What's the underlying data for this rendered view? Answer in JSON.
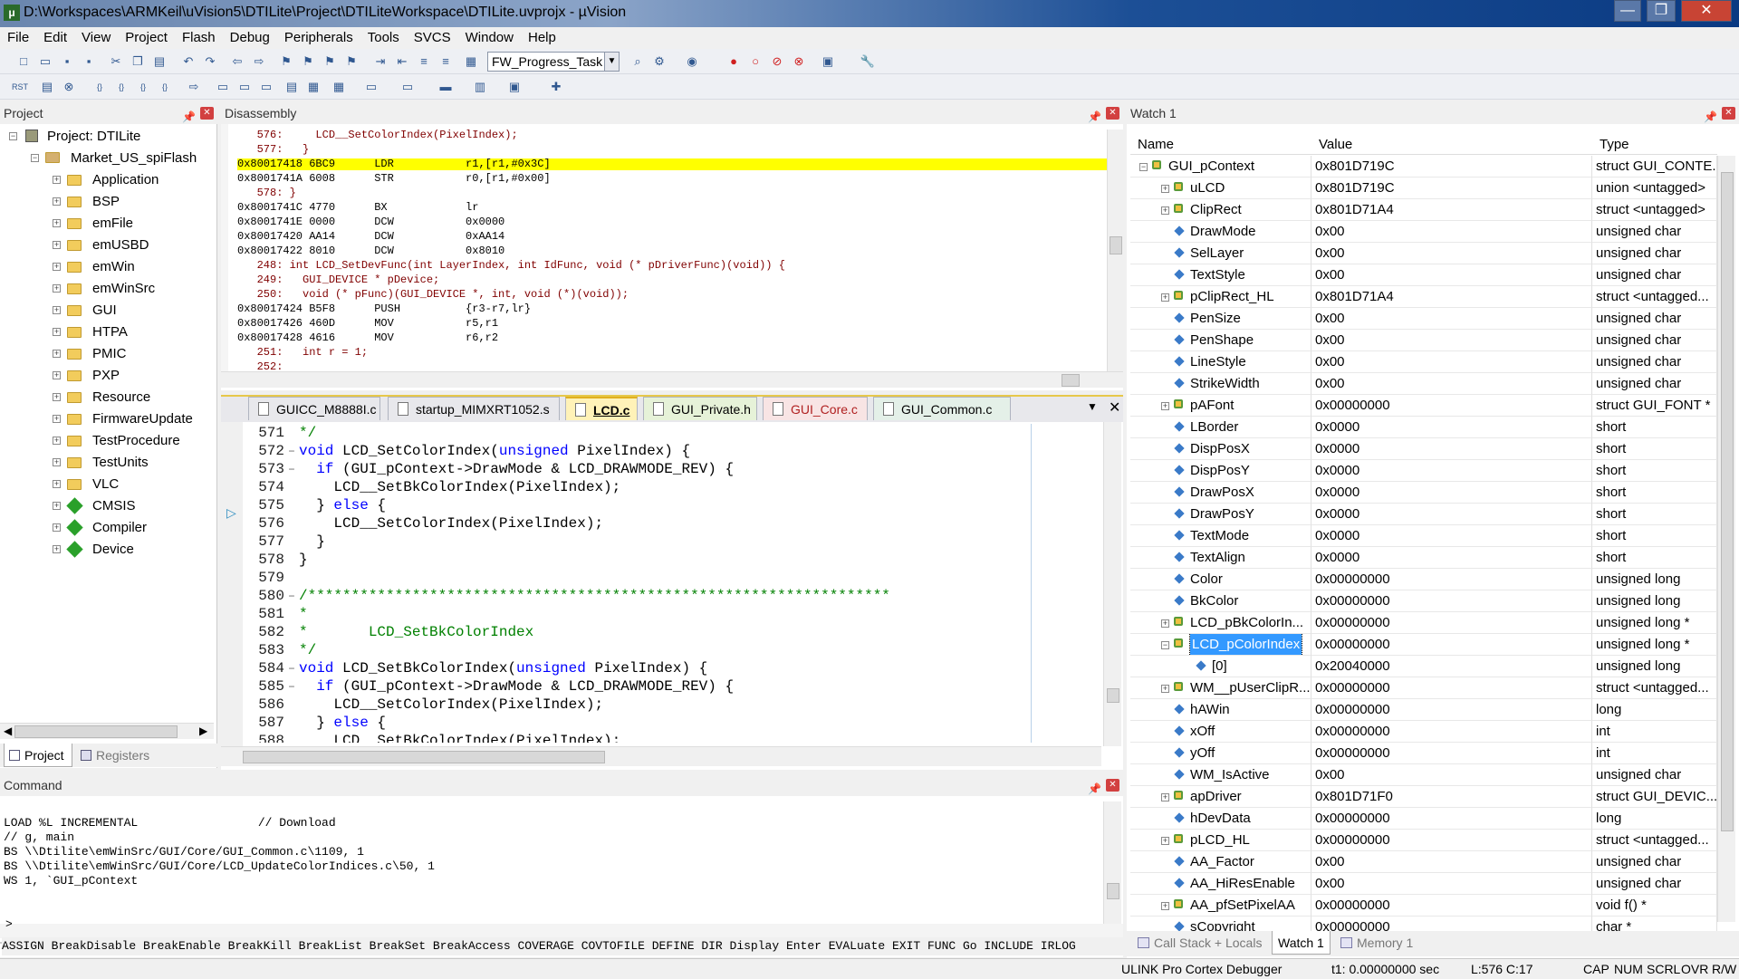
{
  "title": "D:\\Workspaces\\ARMKeil\\uVision5\\DTILite\\Project\\DTILiteWorkspace\\DTILite.uvprojx - µVision",
  "menu": [
    "File",
    "Edit",
    "View",
    "Project",
    "Flash",
    "Debug",
    "Peripherals",
    "Tools",
    "SVCS",
    "Window",
    "Help"
  ],
  "toolbar": {
    "target_combo": "FW_Progress_Task"
  },
  "project": {
    "header": "Project",
    "root": "Project: DTILite",
    "target": "Market_US_spiFlash",
    "groups": [
      "Application",
      "BSP",
      "emFile",
      "emUSBD",
      "emWin",
      "emWinSrc",
      "GUI",
      "HTPA",
      "PMIC",
      "PXP",
      "Resource",
      "FirmwareUpdate",
      "TestProcedure",
      "TestUnits",
      "VLC",
      "CMSIS",
      "Compiler",
      "Device"
    ],
    "tabs": [
      "Project",
      "Registers"
    ]
  },
  "disassembly": {
    "header": "Disassembly",
    "lines": [
      {
        "t": "   576:     LCD__SetColorIndex(PixelIndex);",
        "src": true
      },
      {
        "t": "   577:   }",
        "src": true
      },
      {
        "t": "0x80017418 6BC9      LDR           r1,[r1,#0x3C]",
        "src": false,
        "hl": true
      },
      {
        "t": "0x8001741A 6008      STR           r0,[r1,#0x00]",
        "src": false
      },
      {
        "t": "   578: }",
        "src": true
      },
      {
        "t": "0x8001741C 4770      BX            lr",
        "src": false
      },
      {
        "t": "0x8001741E 0000      DCW           0x0000",
        "src": false
      },
      {
        "t": "0x80017420 AA14      DCW           0xAA14",
        "src": false
      },
      {
        "t": "0x80017422 8010      DCW           0x8010",
        "src": false
      },
      {
        "t": "   248: int LCD_SetDevFunc(int LayerIndex, int IdFunc, void (* pDriverFunc)(void)) {",
        "src": true
      },
      {
        "t": "   249:   GUI_DEVICE * pDevice;",
        "src": true
      },
      {
        "t": "   250:   void (* pFunc)(GUI_DEVICE *, int, void (*)(void));",
        "src": true
      },
      {
        "t": "0x80017424 B5F8      PUSH          {r3-r7,lr}",
        "src": false
      },
      {
        "t": "0x80017426 460D      MOV           r5,r1",
        "src": false
      },
      {
        "t": "0x80017428 4616      MOV           r6,r2",
        "src": false
      },
      {
        "t": "   251:   int r = 1;",
        "src": true
      },
      {
        "t": "   252:",
        "src": true
      }
    ]
  },
  "editor": {
    "tabs": [
      "GUICC_M8888I.c",
      "startup_MIMXRT1052.s",
      "LCD.c",
      "GUI_Private.h",
      "GUI_Core.c",
      "GUI_Common.c"
    ],
    "active_tab": "LCD.c",
    "lines": [
      {
        "n": "571",
        "t": "*/"
      },
      {
        "n": "572",
        "t": "void LCD_SetColorIndex(unsigned PixelIndex) {"
      },
      {
        "n": "573",
        "t": "  if (GUI_pContext->DrawMode & LCD_DRAWMODE_REV) {"
      },
      {
        "n": "574",
        "t": "    LCD__SetBkColorIndex(PixelIndex);"
      },
      {
        "n": "575",
        "t": "  } else {"
      },
      {
        "n": "576",
        "t": "    LCD__SetColorIndex(PixelIndex);"
      },
      {
        "n": "577",
        "t": "  }"
      },
      {
        "n": "578",
        "t": "}"
      },
      {
        "n": "579",
        "t": ""
      },
      {
        "n": "580",
        "t": "/*******************************************************************"
      },
      {
        "n": "581",
        "t": "*"
      },
      {
        "n": "582",
        "t": "*       LCD_SetBkColorIndex"
      },
      {
        "n": "583",
        "t": "*/"
      },
      {
        "n": "584",
        "t": "void LCD_SetBkColorIndex(unsigned PixelIndex) {"
      },
      {
        "n": "585",
        "t": "  if (GUI_pContext->DrawMode & LCD_DRAWMODE_REV) {"
      },
      {
        "n": "586",
        "t": "    LCD__SetColorIndex(PixelIndex);"
      },
      {
        "n": "587",
        "t": "  } else {"
      },
      {
        "n": "588",
        "t": "    LCD__SetBkColorIndex(PixelIndex);"
      }
    ]
  },
  "command": {
    "header": "Command",
    "lines": [
      "LOAD %L INCREMENTAL                 // Download",
      "// g, main",
      "BS \\\\Dtilite\\emWinSrc/GUI/Core/GUI_Common.c\\1109, 1",
      "BS \\\\Dtilite\\emWinSrc/GUI/Core/LCD_UpdateColorIndices.c\\50, 1",
      "WS 1, `GUI_pContext"
    ],
    "prompt": ">",
    "hint": "ASSIGN BreakDisable BreakEnable BreakKill BreakList BreakSet BreakAccess COVERAGE COVTOFILE DEFINE DIR Display Enter EVALuate EXIT FUNC Go INCLUDE IRLOG"
  },
  "watch": {
    "header": "Watch 1",
    "columns": [
      "Name",
      "Value",
      "Type"
    ],
    "rows": [
      {
        "name": "GUI_pContext",
        "value": "0x801D719C",
        "type": "struct GUI_CONTE...",
        "lvl": 0,
        "exp": "-",
        "icon": "struct"
      },
      {
        "name": "uLCD",
        "value": "0x801D719C",
        "type": "union <untagged>",
        "lvl": 1,
        "exp": "+",
        "icon": "struct"
      },
      {
        "name": "ClipRect",
        "value": "0x801D71A4",
        "type": "struct <untagged>",
        "lvl": 1,
        "exp": "+",
        "icon": "struct"
      },
      {
        "name": "DrawMode",
        "value": "0x00",
        "type": "unsigned char",
        "lvl": 1,
        "exp": "",
        "icon": "var"
      },
      {
        "name": "SelLayer",
        "value": "0x00",
        "type": "unsigned char",
        "lvl": 1,
        "exp": "",
        "icon": "var"
      },
      {
        "name": "TextStyle",
        "value": "0x00",
        "type": "unsigned char",
        "lvl": 1,
        "exp": "",
        "icon": "var"
      },
      {
        "name": "pClipRect_HL",
        "value": "0x801D71A4",
        "type": "struct <untagged...",
        "lvl": 1,
        "exp": "+",
        "icon": "struct"
      },
      {
        "name": "PenSize",
        "value": "0x00",
        "type": "unsigned char",
        "lvl": 1,
        "exp": "",
        "icon": "var"
      },
      {
        "name": "PenShape",
        "value": "0x00",
        "type": "unsigned char",
        "lvl": 1,
        "exp": "",
        "icon": "var"
      },
      {
        "name": "LineStyle",
        "value": "0x00",
        "type": "unsigned char",
        "lvl": 1,
        "exp": "",
        "icon": "var"
      },
      {
        "name": "StrikeWidth",
        "value": "0x00",
        "type": "unsigned char",
        "lvl": 1,
        "exp": "",
        "icon": "var"
      },
      {
        "name": "pAFont",
        "value": "0x00000000",
        "type": "struct GUI_FONT *",
        "lvl": 1,
        "exp": "+",
        "icon": "struct"
      },
      {
        "name": "LBorder",
        "value": "0x0000",
        "type": "short",
        "lvl": 1,
        "exp": "",
        "icon": "var"
      },
      {
        "name": "DispPosX",
        "value": "0x0000",
        "type": "short",
        "lvl": 1,
        "exp": "",
        "icon": "var"
      },
      {
        "name": "DispPosY",
        "value": "0x0000",
        "type": "short",
        "lvl": 1,
        "exp": "",
        "icon": "var"
      },
      {
        "name": "DrawPosX",
        "value": "0x0000",
        "type": "short",
        "lvl": 1,
        "exp": "",
        "icon": "var"
      },
      {
        "name": "DrawPosY",
        "value": "0x0000",
        "type": "short",
        "lvl": 1,
        "exp": "",
        "icon": "var"
      },
      {
        "name": "TextMode",
        "value": "0x0000",
        "type": "short",
        "lvl": 1,
        "exp": "",
        "icon": "var"
      },
      {
        "name": "TextAlign",
        "value": "0x0000",
        "type": "short",
        "lvl": 1,
        "exp": "",
        "icon": "var"
      },
      {
        "name": "Color",
        "value": "0x00000000",
        "type": "unsigned long",
        "lvl": 1,
        "exp": "",
        "icon": "var"
      },
      {
        "name": "BkColor",
        "value": "0x00000000",
        "type": "unsigned long",
        "lvl": 1,
        "exp": "",
        "icon": "var"
      },
      {
        "name": "LCD_pBkColorIn...",
        "value": "0x00000000",
        "type": "unsigned long *",
        "lvl": 1,
        "exp": "+",
        "icon": "struct"
      },
      {
        "name": "LCD_pColorIndex",
        "value": "0x00000000",
        "type": "unsigned long *",
        "lvl": 1,
        "exp": "-",
        "icon": "struct",
        "sel": true
      },
      {
        "name": "[0]",
        "value": "0x20040000",
        "type": "unsigned long",
        "lvl": 2,
        "exp": "",
        "icon": "var"
      },
      {
        "name": "WM__pUserClipR...",
        "value": "0x00000000",
        "type": "struct <untagged...",
        "lvl": 1,
        "exp": "+",
        "icon": "struct"
      },
      {
        "name": "hAWin",
        "value": "0x00000000",
        "type": "long",
        "lvl": 1,
        "exp": "",
        "icon": "var"
      },
      {
        "name": "xOff",
        "value": "0x00000000",
        "type": "int",
        "lvl": 1,
        "exp": "",
        "icon": "var"
      },
      {
        "name": "yOff",
        "value": "0x00000000",
        "type": "int",
        "lvl": 1,
        "exp": "",
        "icon": "var"
      },
      {
        "name": "WM_IsActive",
        "value": "0x00",
        "type": "unsigned char",
        "lvl": 1,
        "exp": "",
        "icon": "var"
      },
      {
        "name": "apDriver",
        "value": "0x801D71F0",
        "type": "struct GUI_DEVIC...",
        "lvl": 1,
        "exp": "+",
        "icon": "struct"
      },
      {
        "name": "hDevData",
        "value": "0x00000000",
        "type": "long",
        "lvl": 1,
        "exp": "",
        "icon": "var"
      },
      {
        "name": "pLCD_HL",
        "value": "0x00000000",
        "type": "struct <untagged...",
        "lvl": 1,
        "exp": "+",
        "icon": "struct"
      },
      {
        "name": "AA_Factor",
        "value": "0x00",
        "type": "unsigned char",
        "lvl": 1,
        "exp": "",
        "icon": "var"
      },
      {
        "name": "AA_HiResEnable",
        "value": "0x00",
        "type": "unsigned char",
        "lvl": 1,
        "exp": "",
        "icon": "var"
      },
      {
        "name": "AA_pfSetPixelAA",
        "value": "0x00000000",
        "type": "void f()  *",
        "lvl": 1,
        "exp": "+",
        "icon": "struct"
      },
      {
        "name": "sCopyright",
        "value": "0x00000000",
        "type": "char *",
        "lvl": 1,
        "exp": "",
        "icon": "var"
      }
    ],
    "tabs": [
      "Call Stack + Locals",
      "Watch 1",
      "Memory 1"
    ]
  },
  "status": {
    "debugger": "ULINK Pro Cortex Debugger",
    "time": "t1: 0.00000000 sec",
    "pos": "L:576 C:17",
    "caps": "CAP",
    "num": "NUM",
    "scrl": "SCRL",
    "ovr": "OVR",
    "rw": "R/W"
  }
}
